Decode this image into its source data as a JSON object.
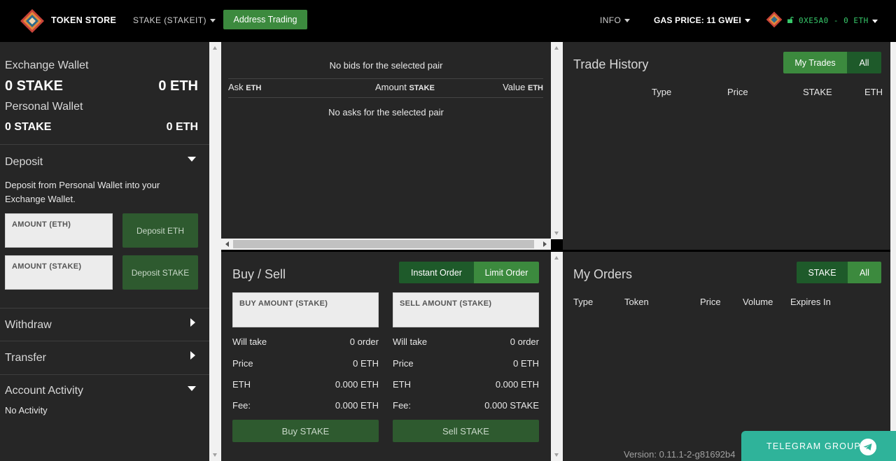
{
  "navbar": {
    "brand": "TOKEN STORE",
    "token_menu": "STAKE (STAKEIT)",
    "address_trading": "Address Trading",
    "info_menu": "INFO",
    "gas_price": "GAS PRICE: 11 GWEI",
    "account": "0XE5A0 - 0 ETH"
  },
  "wallet": {
    "exchange_title": "Exchange Wallet",
    "exchange_token": "0 STAKE",
    "exchange_eth": "0 ETH",
    "personal_title": "Personal Wallet",
    "personal_token": "0 STAKE",
    "personal_eth": "0 ETH"
  },
  "deposit": {
    "title": "Deposit",
    "description": "Deposit from Personal Wallet into your Exchange Wallet.",
    "amount_eth_placeholder": "AMOUNT (ETH)",
    "deposit_eth_button": "Deposit ETH",
    "amount_stake_placeholder": "AMOUNT (STAKE)",
    "deposit_stake_button": "Deposit STAKE"
  },
  "withdraw": {
    "title": "Withdraw"
  },
  "transfer": {
    "title": "Transfer"
  },
  "activity": {
    "title": "Account Activity",
    "empty": "No Activity"
  },
  "orderbook": {
    "no_bids": "No bids for the selected pair",
    "col_ask": "Ask",
    "col_ask_unit": "ETH",
    "col_amount": "Amount",
    "col_amount_unit": "STAKE",
    "col_value": "Value",
    "col_value_unit": "ETH",
    "no_asks": "No asks for the selected pair"
  },
  "buysell": {
    "title": "Buy / Sell",
    "instant_order": "Instant Order",
    "limit_order": "Limit Order",
    "buy_placeholder": "BUY AMOUNT (STAKE)",
    "sell_placeholder": "SELL AMOUNT (STAKE)",
    "buy": {
      "will_take_label": "Will take",
      "will_take_value": "0 order",
      "price_label": "Price",
      "price_value": "0 ETH",
      "eth_label": "ETH",
      "eth_value": "0.000 ETH",
      "fee_label": "Fee:",
      "fee_value": "0.000 ETH",
      "button": "Buy STAKE"
    },
    "sell": {
      "will_take_label": "Will take",
      "will_take_value": "0 order",
      "price_label": "Price",
      "price_value": "0 ETH",
      "eth_label": "ETH",
      "eth_value": "0.000 ETH",
      "fee_label": "Fee:",
      "fee_value": "0.000 STAKE",
      "button": "Sell STAKE"
    }
  },
  "trade_history": {
    "title": "Trade History",
    "my_trades": "My Trades",
    "all": "All",
    "columns": [
      "Type",
      "Price",
      "STAKE",
      "ETH"
    ]
  },
  "my_orders": {
    "title": "My Orders",
    "filter_token": "STAKE",
    "all": "All",
    "columns": [
      "Type",
      "Token",
      "Price",
      "Volume",
      "Expires In"
    ]
  },
  "footer": {
    "version": "Version: 0.11.1-2-g81692b4",
    "telegram": "TELEGRAM GROUP"
  },
  "colors": {
    "accent_green": "#3c8a3e",
    "dark_green": "#1e5a2a",
    "panel": "#262626",
    "account_green": "#37c86a",
    "telegram": "#2fb39a"
  }
}
